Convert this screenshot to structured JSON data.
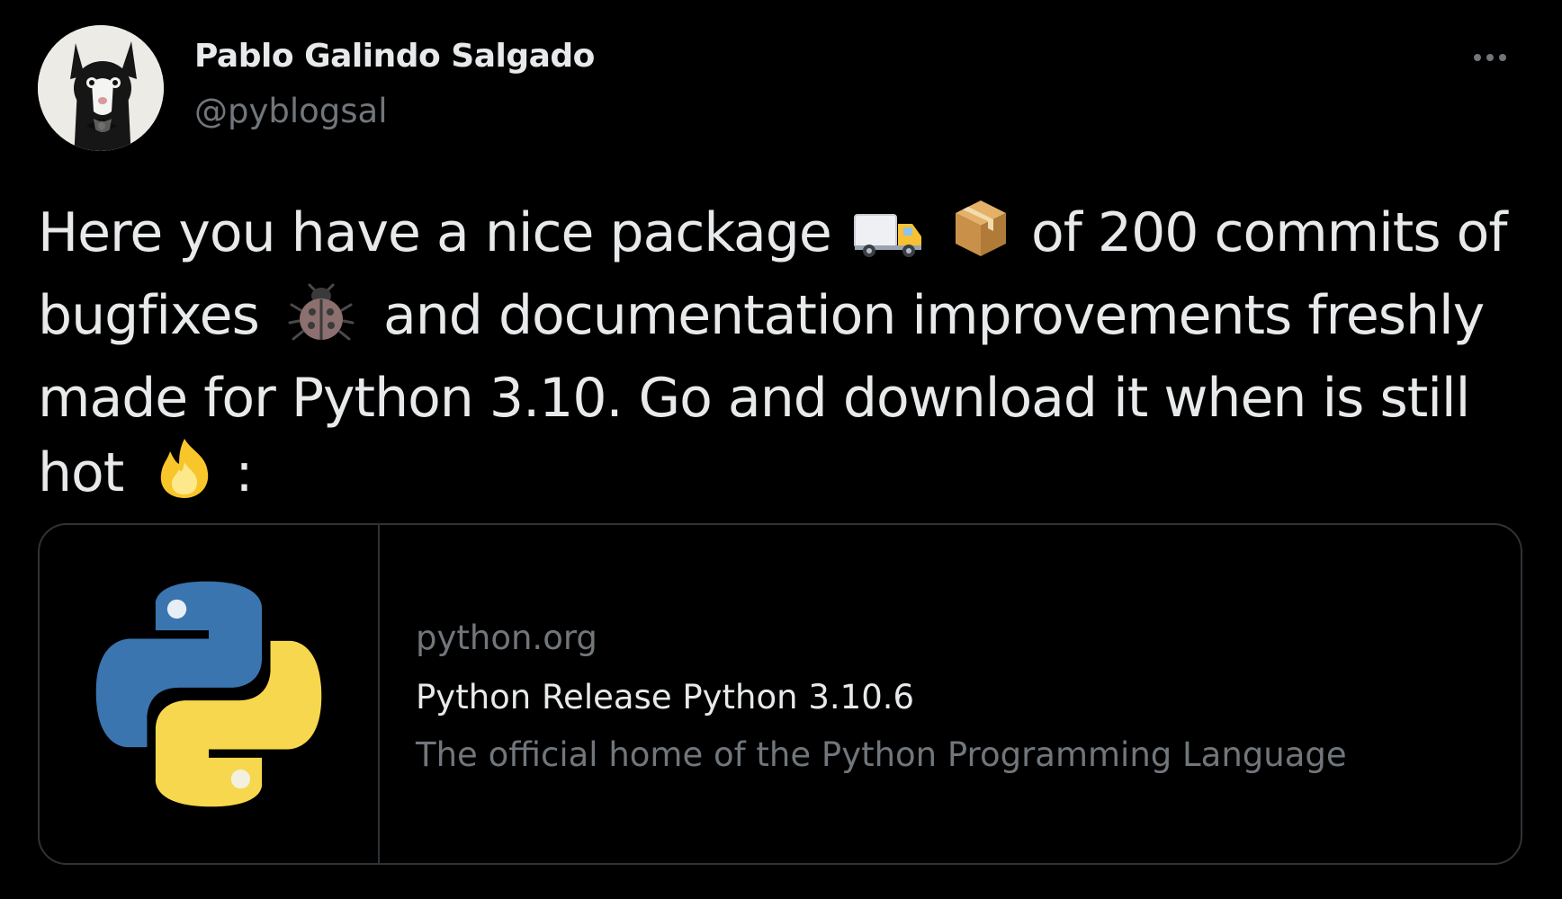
{
  "author": {
    "display_name": "Pablo Galindo Salgado",
    "handle": "@pyblogsal",
    "avatar_icon": "cat-avatar-icon"
  },
  "menu": {
    "icon": "more-options-icon"
  },
  "tweet": {
    "line1_a": "Here you have a nice package",
    "line1_b": "of 200 commits of",
    "line2_a": "bugfixes",
    "line2_b": "and documentation improvements freshly",
    "line3": "made for Python 3.10. Go and download it when is still",
    "line4_a": "hot",
    "line4_b": ":",
    "emojis": [
      "delivery-truck-icon",
      "package-icon",
      "ladybug-icon",
      "fire-icon"
    ]
  },
  "card": {
    "domain": "python.org",
    "title": "Python Release Python 3.10.6",
    "description": "The official home of the Python Programming Language",
    "image_icon": "python-logo-icon"
  },
  "colors": {
    "background": "#000000",
    "text_primary": "#e7e9ea",
    "text_secondary": "#71767b",
    "border": "#2f3336",
    "python_blue": "#3a75b0",
    "python_yellow": "#f7d74d"
  }
}
